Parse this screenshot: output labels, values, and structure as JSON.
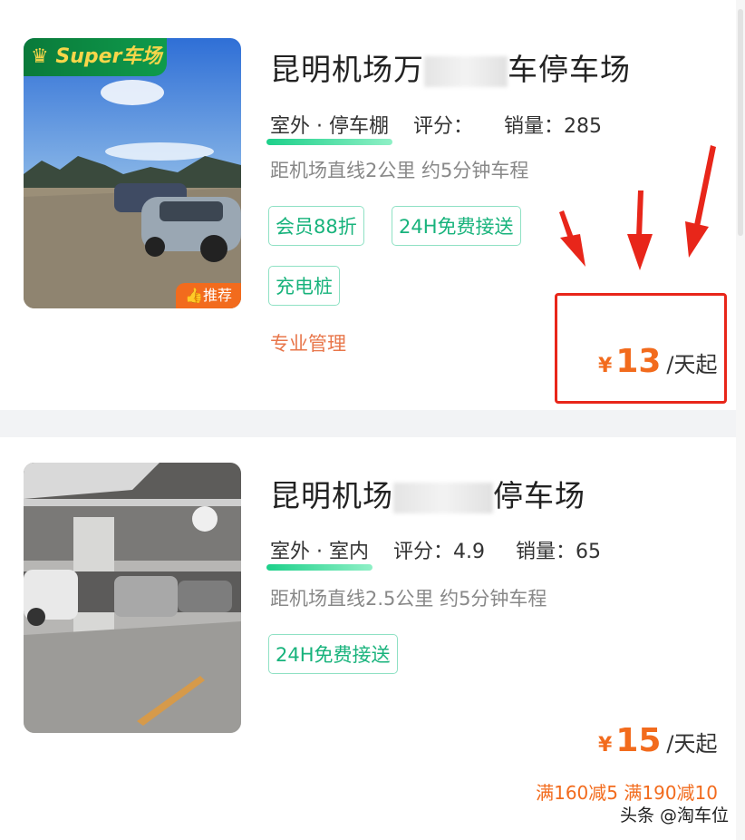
{
  "listings": [
    {
      "badge_text": "Super车场",
      "recommend_label": "推荐",
      "title_prefix": "昆明机场万",
      "title_suffix": "车停车场",
      "type_text": "室外 · 停车棚",
      "rating_label": "评分：",
      "rating_value": "",
      "sales_label": "销量：",
      "sales_value": "285",
      "distance_text": "距机场直线2公里 约5分钟车程",
      "tags": [
        "会员88折",
        "24H免费接送",
        "充电桩"
      ],
      "feature_text": "专业管理",
      "price_symbol": "¥",
      "price_value": "13",
      "price_unit": "/天起"
    },
    {
      "title_prefix": "昆明机场",
      "title_suffix": "停车场",
      "type_text": "室外 · 室内",
      "rating_label": "评分：",
      "rating_value": "4.9",
      "sales_label": "销量：",
      "sales_value": "65",
      "distance_text": "距机场直线2.5公里 约5分钟车程",
      "tags": [
        "24H免费接送"
      ],
      "price_symbol": "¥",
      "price_value": "15",
      "price_unit": "/天起",
      "coupon_text": "满160减5 满190减10"
    }
  ],
  "watermark_text": "头条 @淘车位",
  "colors": {
    "accent_orange": "#f26b1d",
    "tag_green": "#18b37c",
    "annotation_red": "#e8261a"
  }
}
